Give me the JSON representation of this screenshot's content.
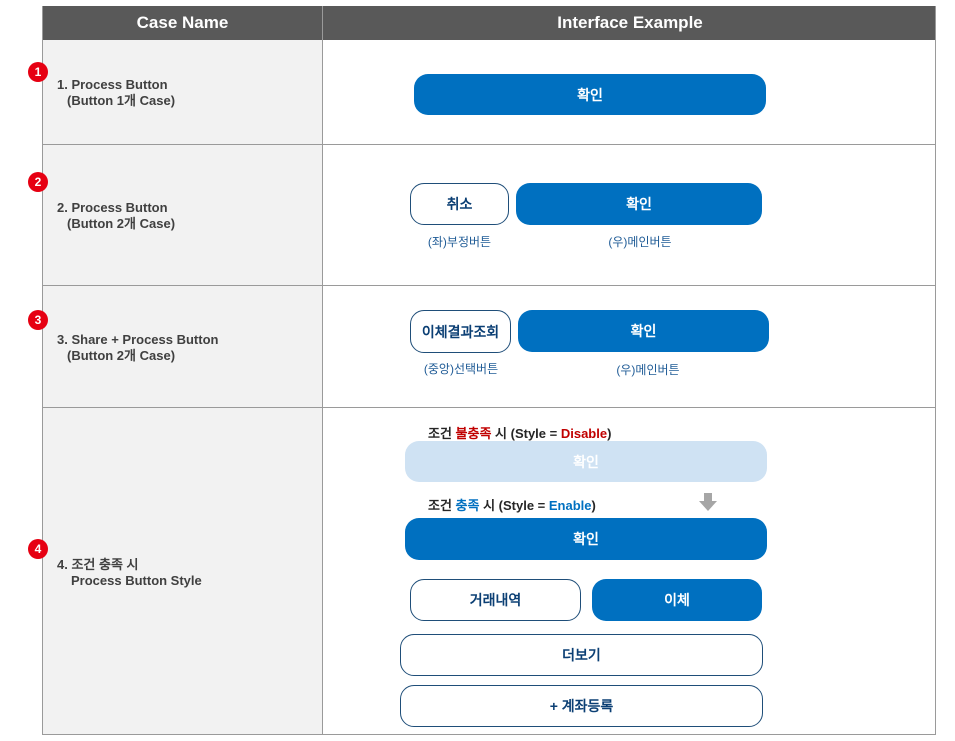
{
  "header": {
    "col1": "Case Name",
    "col2": "Interface Example"
  },
  "cases": [
    {
      "badge": "1",
      "line1": "1. Process Button",
      "line2": "(Button 1개 Case)"
    },
    {
      "badge": "2",
      "line1": "2. Process Button",
      "line2": "(Button 2개 Case)"
    },
    {
      "badge": "3",
      "line1": "3. Share + Process Button",
      "line2": "(Button 2개 Case)"
    },
    {
      "badge": "4",
      "line1": "4. 조건 충족 시",
      "line2": "Process Button Style"
    }
  ],
  "row1": {
    "confirm": "확인"
  },
  "row2": {
    "cancel": "취소",
    "confirm": "확인",
    "cap_left": "(좌)부정버튼",
    "cap_right": "(우)메인버튼"
  },
  "row3": {
    "transfer_result": "이체결과조회",
    "confirm": "확인",
    "cap_left": "(중앙)선택버튼",
    "cap_right": "(우)메인버튼"
  },
  "row4": {
    "cond_disable_prefix": "조건 ",
    "cond_disable_word": "불충족",
    "cond_disable_mid": " 시 (Style = ",
    "cond_disable_value": "Disable",
    "cond_disable_suffix": ")",
    "disabled_confirm": "확인",
    "cond_enable_prefix": "조건 ",
    "cond_enable_word": "충족",
    "cond_enable_mid": " 시 (Style = ",
    "cond_enable_value": "Enable",
    "cond_enable_suffix": ")",
    "enabled_confirm": "확인",
    "history": "거래내역",
    "transfer": "이체",
    "more": "더보기",
    "register_account": "+ 계좌등록"
  },
  "colors": {
    "primary": "#0070c0",
    "disabled": "#cfe2f3",
    "badge": "#e60012",
    "header": "#595959",
    "disable_text": "#c00000"
  },
  "icons": {
    "arrow": "down-arrow-icon"
  }
}
